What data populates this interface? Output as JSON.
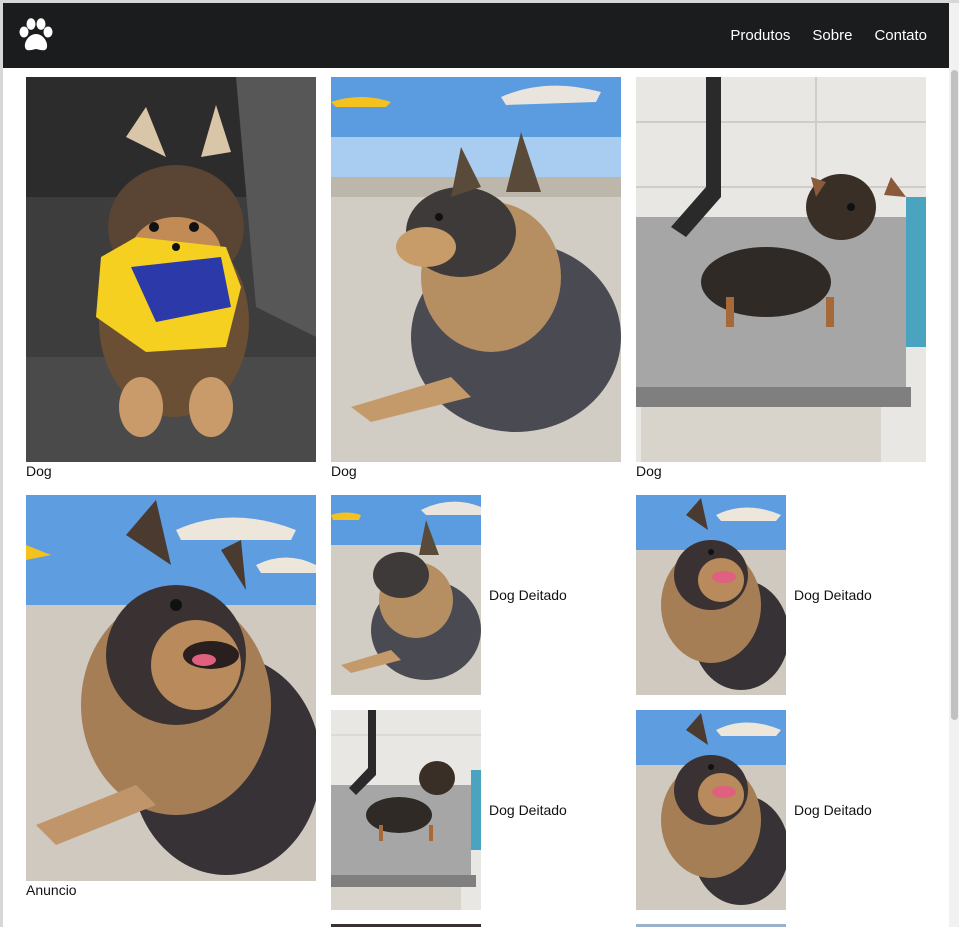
{
  "nav": {
    "logo": "paw-icon",
    "links": [
      "Produtos",
      "Sobre",
      "Contato"
    ]
  },
  "gallery": {
    "row1": [
      "Dog",
      "Dog",
      "Dog"
    ],
    "featured": "Anuncio",
    "thumbs": [
      "Dog Deitado",
      "Dog Deitado",
      "Dog Deitado",
      "Dog Deitado"
    ]
  },
  "colors": {
    "navbar": "#1b1c1e",
    "text": "#111111",
    "accent_sweater": "#f5d020",
    "sky": "#4a90d9"
  }
}
